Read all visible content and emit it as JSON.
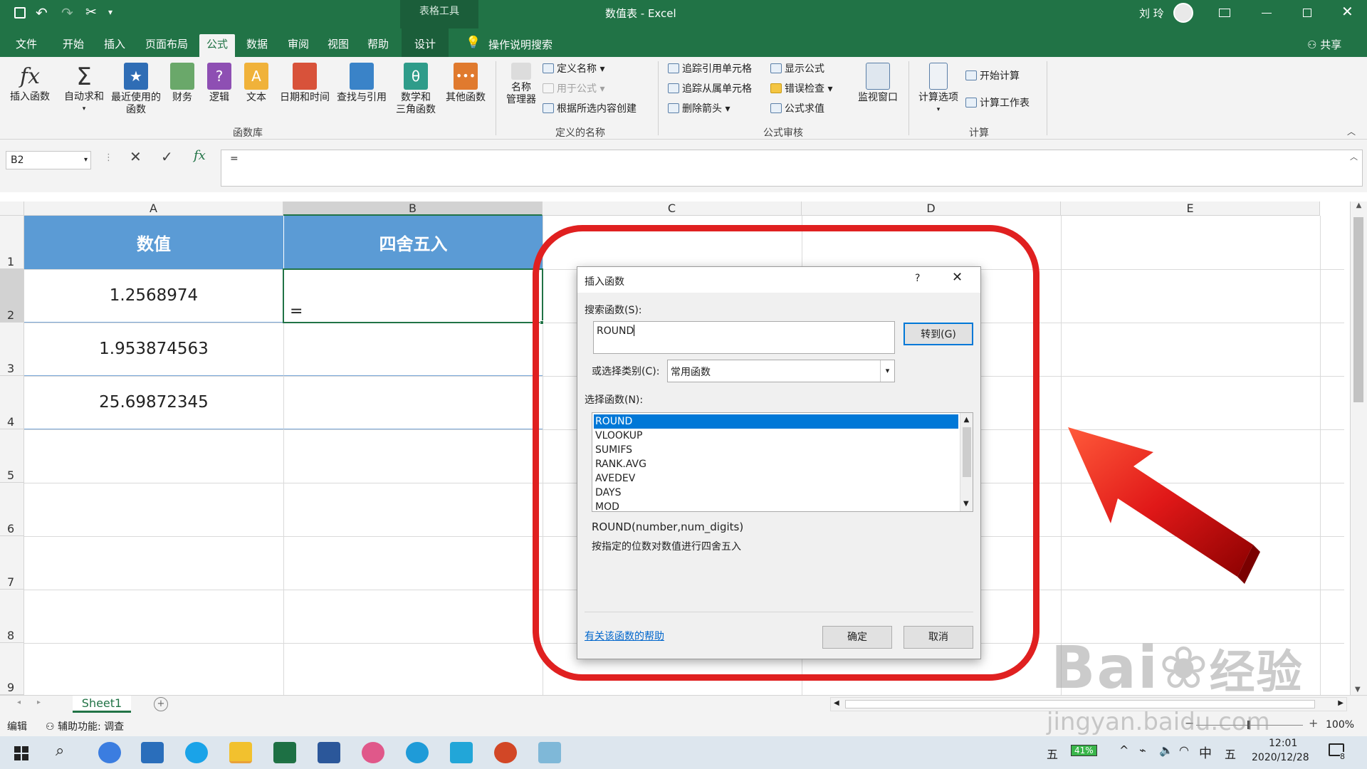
{
  "titlebar": {
    "context_tab": "表格工具",
    "title": "数值表 - Excel",
    "user": "刘 玲"
  },
  "tabs": [
    "文件",
    "开始",
    "插入",
    "页面布局",
    "公式",
    "数据",
    "审阅",
    "视图",
    "帮助",
    "设计"
  ],
  "active_tab": "公式",
  "search_hint": "操作说明搜索",
  "share": "共享",
  "ribbon": {
    "insert_function": "插入函数",
    "autosum": "自动求和",
    "recent_1": "最近使用的",
    "recent_2": "函数",
    "finance": "财务",
    "logic": "逻辑",
    "text": "文本",
    "datetime": "日期和时间",
    "lookup": "查找与引用",
    "math_1": "数学和",
    "math_2": "三角函数",
    "other": "其他函数",
    "group_library": "函数库",
    "name_manager_1": "名称",
    "name_manager_2": "管理器",
    "define_name": "定义名称",
    "use_in_formula": "用于公式",
    "create_from_selection": "根据所选内容创建",
    "group_names": "定义的名称",
    "trace_precedents": "追踪引用单元格",
    "trace_dependents": "追踪从属单元格",
    "remove_arrows": "删除箭头",
    "show_formulas": "显示公式",
    "error_checking": "错误检查",
    "evaluate_formula": "公式求值",
    "watch_window": "监视窗口",
    "group_audit": "公式审核",
    "calc_options": "计算选项",
    "calc_now": "开始计算",
    "calc_sheet": "计算工作表",
    "group_calc": "计算"
  },
  "formula_bar": {
    "name_box": "B2",
    "formula": "="
  },
  "grid": {
    "columns": [
      "A",
      "B",
      "C",
      "D",
      "E"
    ],
    "rows": [
      "1",
      "2",
      "3",
      "4",
      "5",
      "6",
      "7",
      "8",
      "9"
    ],
    "header_a": "数值",
    "header_b": "四舍五入",
    "values": [
      "1.2568974",
      "1.953874563",
      "25.69872345"
    ],
    "b2_value": "="
  },
  "dialog": {
    "title": "插入函数",
    "help": "?",
    "search_label": "搜索函数(S):",
    "search_value": "ROUND",
    "goto": "转到(G)",
    "category_label": "或选择类别(C):",
    "category_value": "常用函数",
    "select_label": "选择函数(N):",
    "functions": [
      "ROUND",
      "VLOOKUP",
      "SUMIFS",
      "RANK.AVG",
      "AVEDEV",
      "DAYS",
      "MOD"
    ],
    "signature": "ROUND(number,num_digits)",
    "description": "按指定的位数对数值进行四舍五入",
    "help_link": "有关该函数的帮助",
    "ok": "确定",
    "cancel": "取消"
  },
  "sheet_tab": "Sheet1",
  "status": {
    "mode": "编辑",
    "accessibility": "辅助功能: 调查",
    "zoom": "100%"
  },
  "taskbar": {
    "ime_1": "五",
    "battery": "41%",
    "ime_2": "中",
    "ime_3": "五",
    "time": "12:01",
    "date": "2020/12/28",
    "notify": "8"
  },
  "watermark": {
    "brand": "Bai",
    "brand_cn": "经验",
    "url": "jingyan.baidu.com"
  },
  "colors": {
    "excel_green": "#217346",
    "header_fill": "#5b9bd5",
    "annotation_red": "#e02020",
    "selection": "#0078d7"
  }
}
